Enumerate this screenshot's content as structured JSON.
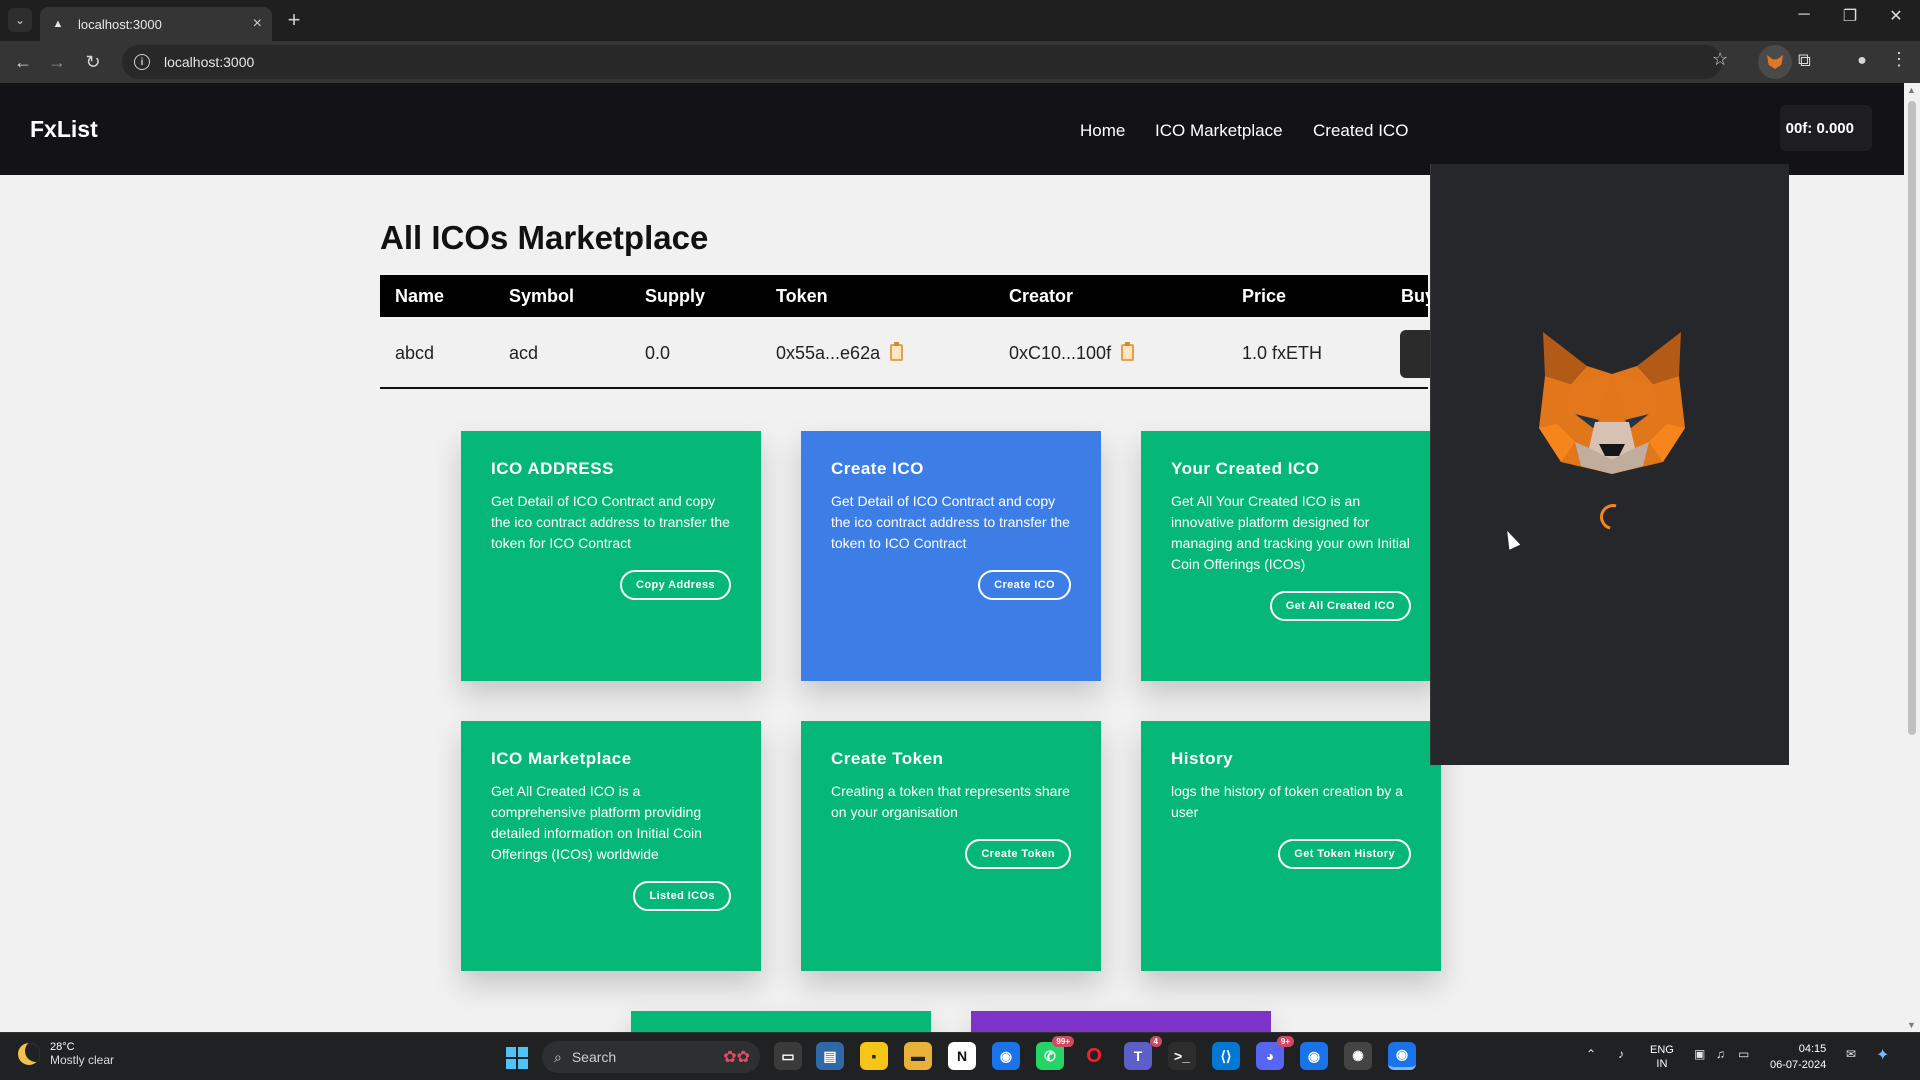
{
  "browser": {
    "tab_title": "localhost:3000",
    "url": "localhost:3000"
  },
  "site": {
    "logo": "FxList",
    "nav": [
      "Home",
      "ICO Marketplace",
      "Created ICO"
    ],
    "wallet_text": "00f: 0.000"
  },
  "page": {
    "title": "All ICOs Marketplace",
    "table": {
      "headers": [
        "Name",
        "Symbol",
        "Supply",
        "Token",
        "Creator",
        "Price",
        "Buy"
      ],
      "rows": [
        {
          "name": "abcd",
          "symbol": "acd",
          "supply": "0.0",
          "token": "0x55a...e62a",
          "creator": "0xC10...100f",
          "price": "1.0 fxETH"
        }
      ]
    }
  },
  "cards": [
    {
      "title": "ICO ADDRESS",
      "text": "Get Detail of ICO Contract and copy the ico contract address to transfer the token for ICO Contract",
      "button": "Copy Address",
      "color": "#06b877"
    },
    {
      "title": "Create ICO",
      "text": "Get Detail of ICO Contract and copy the ico contract address to transfer the token to ICO Contract",
      "button": "Create ICO",
      "color": "#3d7ee6"
    },
    {
      "title": "Your Created ICO",
      "text": "Get All Your Created ICO is an innovative platform designed for managing and tracking your own Initial Coin Offerings (ICOs)",
      "button": "Get All Created ICO",
      "color": "#06b877"
    },
    {
      "title": "ICO Marketplace",
      "text": "Get All Created ICO is a comprehensive platform providing detailed information on Initial Coin Offerings (ICOs) worldwide",
      "button": "Listed ICOs",
      "color": "#06b877"
    },
    {
      "title": "Create Token",
      "text": "Creating a token that represents share on your organisation",
      "button": "Create Token",
      "color": "#06b877"
    },
    {
      "title": "History",
      "text": "logs the history of token creation by a user",
      "button": "Get Token History",
      "color": "#06b877"
    }
  ],
  "taskbar": {
    "weather_temp": "28°C",
    "weather_desc": "Mostly clear",
    "search": "Search",
    "whatsapp_badge": "99+",
    "teams_badge": "4",
    "discord_badge": "9+",
    "lang1": "ENG",
    "lang2": "IN",
    "time": "04:15",
    "date": "06-07-2024"
  },
  "colors": {
    "card_green": "#06b877",
    "card_blue": "#3d7ee6",
    "card_purple": "#7e32c8",
    "metamask_orange": "#f6851b"
  }
}
